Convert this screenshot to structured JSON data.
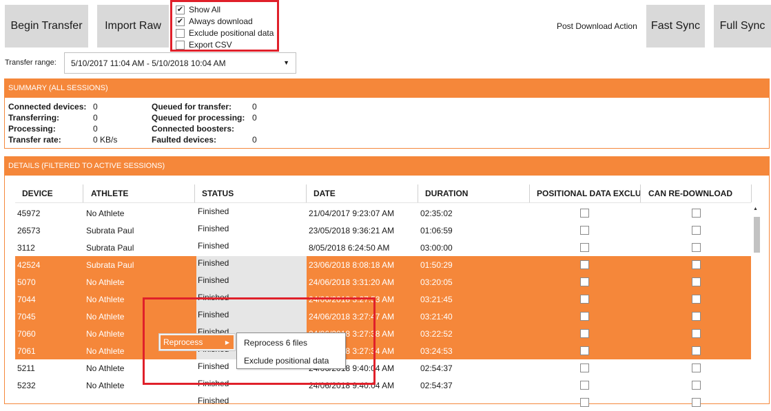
{
  "toolbar": {
    "begin_transfer": "Begin Transfer",
    "import_raw": "Import Raw",
    "post_download_action": "Post Download Action",
    "fast_sync": "Fast Sync",
    "full_sync": "Full Sync"
  },
  "options": [
    {
      "label": "Show All",
      "checked": true
    },
    {
      "label": "Always download",
      "checked": true
    },
    {
      "label": "Exclude positional data",
      "checked": false
    },
    {
      "label": "Export CSV",
      "checked": false
    }
  ],
  "transfer_range": {
    "label": "Transfer range:",
    "value": "5/10/2017 11:04 AM - 5/10/2018 10:04 AM"
  },
  "summary": {
    "title": "SUMMARY (ALL SESSIONS)",
    "left": [
      {
        "label": "Connected devices:",
        "value": "0"
      },
      {
        "label": "Transferring:",
        "value": "0"
      },
      {
        "label": "Processing:",
        "value": "0"
      },
      {
        "label": "Transfer rate:",
        "value": "0 KB/s"
      }
    ],
    "right": [
      {
        "label": "Queued for transfer:",
        "value": "0"
      },
      {
        "label": "Queued for processing:",
        "value": "0"
      },
      {
        "label": "Connected boosters:",
        "value": ""
      },
      {
        "label": "Faulted devices:",
        "value": "0"
      }
    ]
  },
  "details": {
    "title": "DETAILS (FILTERED TO ACTIVE SESSIONS)",
    "columns": [
      "DEVICE",
      "ATHLETE",
      "STATUS",
      "DATE",
      "DURATION",
      "POSITIONAL DATA EXCLU",
      "CAN RE-DOWNLOAD"
    ],
    "rows": [
      {
        "device": "45972",
        "athlete": "No Athlete",
        "status": "Finished",
        "date": "21/04/2017 9:23:07 AM",
        "duration": "02:35:02",
        "selected": false
      },
      {
        "device": "26573",
        "athlete": "Subrata Paul",
        "status": "Finished",
        "date": "23/05/2018 9:36:21 AM",
        "duration": "01:06:59",
        "selected": false
      },
      {
        "device": "3112",
        "athlete": "Subrata Paul",
        "status": "Finished",
        "date": "8/05/2018 6:24:50 AM",
        "duration": "03:00:00",
        "selected": false
      },
      {
        "device": "42524",
        "athlete": "Subrata Paul",
        "status": "Finished",
        "date": "23/06/2018 8:08:18 AM",
        "duration": "01:50:29",
        "selected": true
      },
      {
        "device": "5070",
        "athlete": "No Athlete",
        "status": "Finished",
        "date": "24/06/2018 3:31:20 AM",
        "duration": "03:20:05",
        "selected": true
      },
      {
        "device": "7044",
        "athlete": "No Athlete",
        "status": "Finished",
        "date": "24/06/2018 3:27:53 AM",
        "duration": "03:21:45",
        "selected": true
      },
      {
        "device": "7045",
        "athlete": "No Athlete",
        "status": "Finished",
        "date": "24/06/2018 3:27:47 AM",
        "duration": "03:21:40",
        "selected": true
      },
      {
        "device": "7060",
        "athlete": "No Athlete",
        "status": "Finished",
        "date": "24/06/2018 3:27:38 AM",
        "duration": "03:22:52",
        "selected": true
      },
      {
        "device": "7061",
        "athlete": "No Athlete",
        "status": "Finished",
        "date": "24/06/2018 3:27:34 AM",
        "duration": "03:24:53",
        "selected": true
      },
      {
        "device": "5211",
        "athlete": "No Athlete",
        "status": "Finished",
        "date": "24/06/2018 9:40:04 AM",
        "duration": "02:54:37",
        "selected": false
      },
      {
        "device": "5232",
        "athlete": "No Athlete",
        "status": "Finished",
        "date": "24/06/2018 9:40:04 AM",
        "duration": "02:54:37",
        "selected": false
      },
      {
        "device": "",
        "athlete": "",
        "status": "Finished",
        "date": "",
        "duration": "",
        "selected": false
      }
    ]
  },
  "context_menu": {
    "item": "Reprocess",
    "submenu": [
      "Reprocess 6 files",
      "Exclude positional data"
    ]
  },
  "colors": {
    "accent": "#f5873a",
    "highlight_box": "#e0202a",
    "button_bg": "#d9d9d9"
  }
}
